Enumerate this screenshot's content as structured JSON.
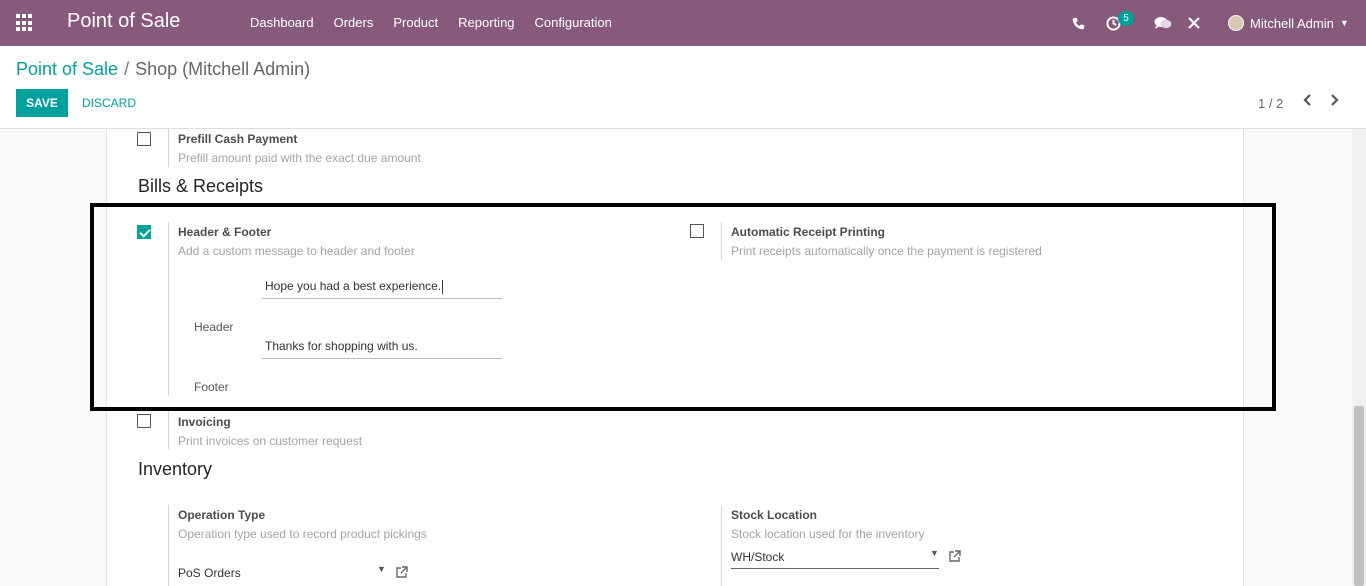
{
  "app": {
    "title": "Point of Sale"
  },
  "menu": [
    "Dashboard",
    "Orders",
    "Product",
    "Reporting",
    "Configuration"
  ],
  "systray": {
    "activity_count": "5",
    "user_name": "Mitchell Admin"
  },
  "breadcrumb": {
    "parent": "Point of Sale",
    "separator": "/",
    "current": "Shop (Mitchell Admin)"
  },
  "buttons": {
    "save": "SAVE",
    "discard": "DISCARD"
  },
  "pager": {
    "value": "1 / 2"
  },
  "prefill": {
    "title": "Prefill Cash Payment",
    "desc": "Prefill amount paid with the exact due amount",
    "checked": false
  },
  "bills": {
    "section": "Bills & Receipts",
    "header_footer": {
      "title": "Header & Footer",
      "desc": "Add a custom message to header and footer",
      "checked": true
    },
    "header_label": "Header",
    "header_value": "Hope you had a best experience.",
    "footer_label": "Footer",
    "footer_value": "Thanks for shopping with us.",
    "auto_print": {
      "title": "Automatic Receipt Printing",
      "desc": "Print receipts automatically once the payment is registered",
      "checked": false
    }
  },
  "invoicing": {
    "title": "Invoicing",
    "desc": "Print invoices on customer request",
    "checked": false
  },
  "inventory": {
    "section": "Inventory",
    "operation_type": {
      "title": "Operation Type",
      "desc": "Operation type used to record product pickings",
      "value": "PoS Orders"
    },
    "stock_location": {
      "title": "Stock Location",
      "desc": "Stock location used for the inventory",
      "value": "WH/Stock"
    }
  },
  "colors": {
    "navbar": "#875a7b",
    "accent": "#00a09d"
  }
}
